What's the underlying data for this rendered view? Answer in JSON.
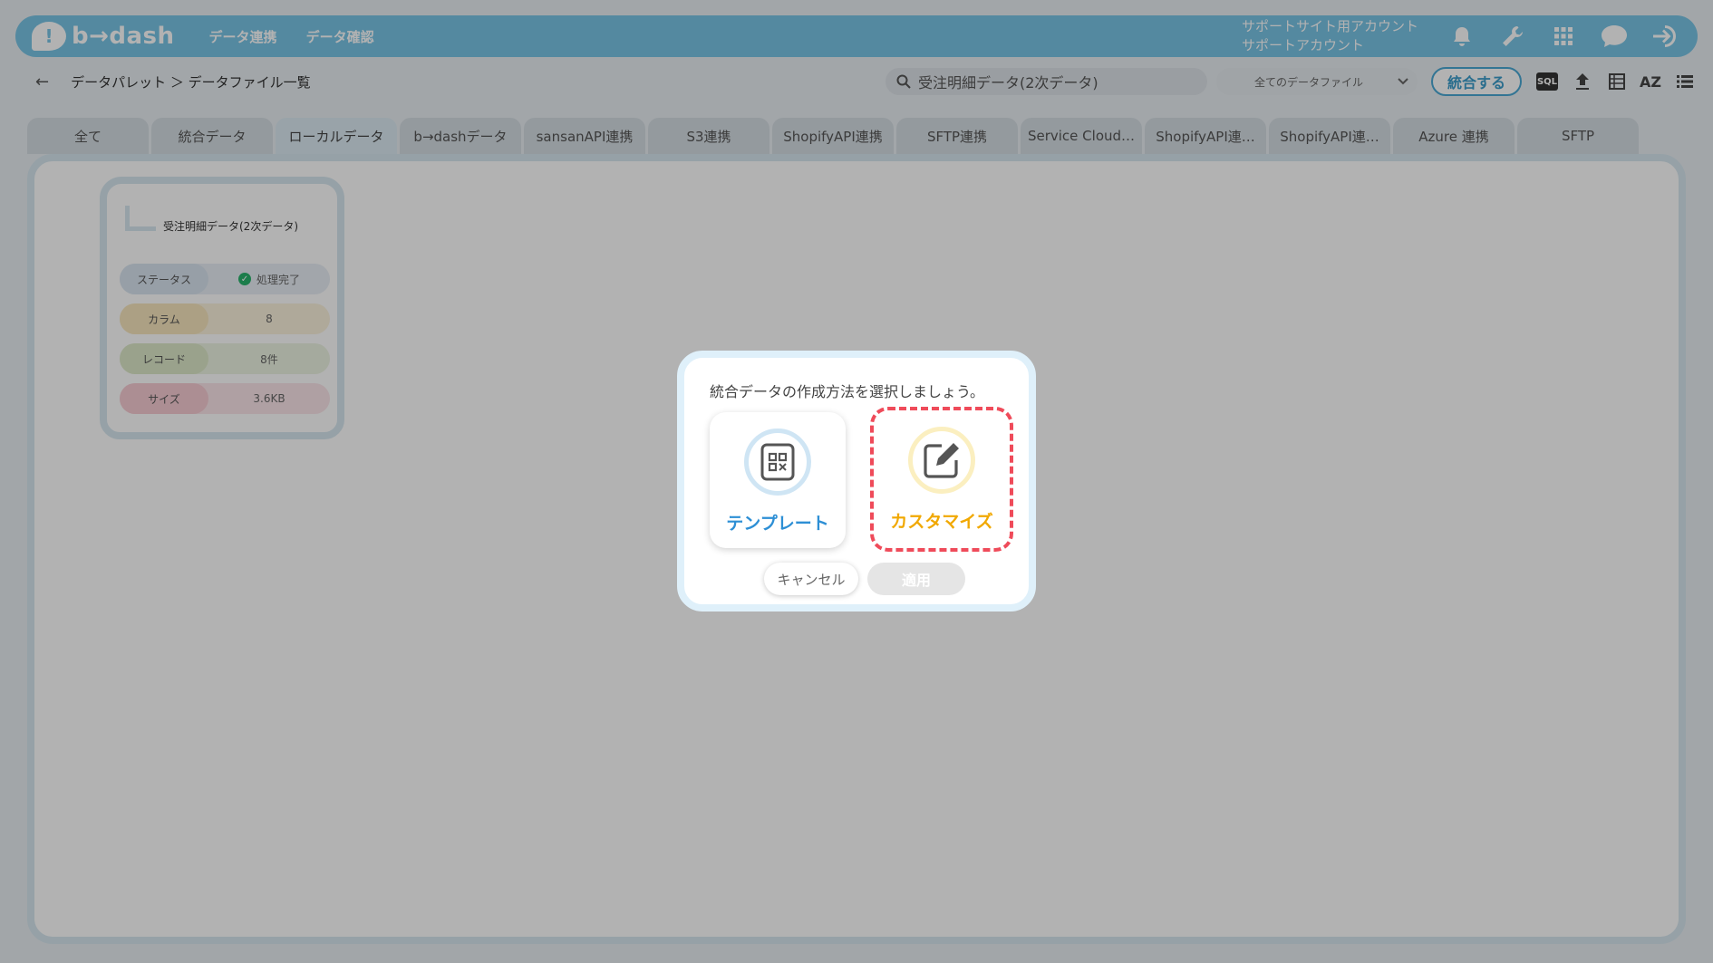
{
  "header": {
    "logo_mark": "!",
    "logo_text": "b→dash",
    "nav": [
      "データ連携",
      "データ確認"
    ],
    "account_line1": "サポートサイト用アカウント",
    "account_line2": "サポートアカウント",
    "icons": [
      "bell-icon",
      "wrench-icon",
      "grid-icon",
      "chat-icon",
      "logout-icon"
    ],
    "color": "#79c4e6"
  },
  "toolbar": {
    "back_icon": "←",
    "breadcrumb": "データパレット ＞ データファイル一覧",
    "search_value": "受注明細データ(2次データ)",
    "filter_selected": "全てのデータファイル",
    "merge_label": "統合する",
    "sql_label": "SQL",
    "sort_label": "AZ"
  },
  "tabs": [
    "全て",
    "統合データ",
    "ローカルデータ",
    "b→dashデータ",
    "sansanAPI連携",
    "S3連携",
    "ShopifyAPI連携",
    "SFTP連携",
    "Service Cloud…",
    "ShopifyAPI連…",
    "ShopifyAPI連…",
    "Azure 連携",
    "SFTP"
  ],
  "active_tab": "ローカルデータ",
  "file_card": {
    "title": "受注明細データ(2次データ)",
    "rows": [
      {
        "key": "ステータス",
        "value": "処理完了"
      },
      {
        "key": "カラム",
        "value": "8"
      },
      {
        "key": "レコード",
        "value": "8件"
      },
      {
        "key": "サイズ",
        "value": "3.6KB"
      }
    ]
  },
  "dialog": {
    "message": "統合データの作成方法を選択しましょう。",
    "template_label": "テンプレート",
    "custom_label": "カスタマイズ",
    "cancel_label": "キャンセル",
    "apply_label": "適用"
  }
}
